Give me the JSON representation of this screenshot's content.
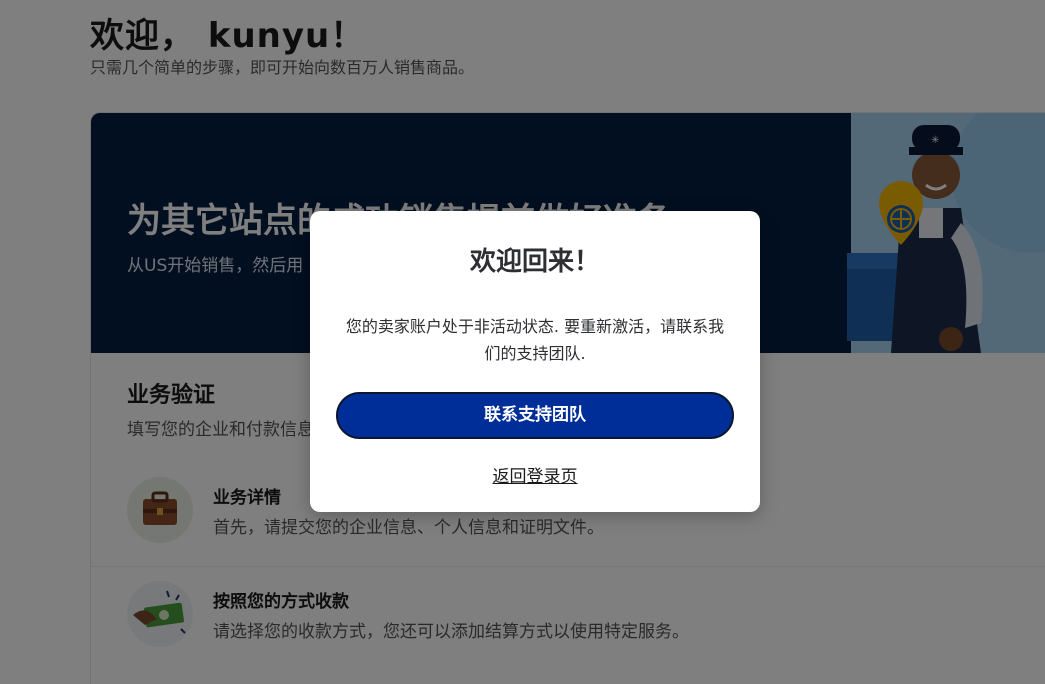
{
  "header": {
    "greeting": "欢迎， kunyu！",
    "subtitle": "只需几个简单的步骤，即可开始向数百万人销售商品。"
  },
  "banner": {
    "title": "为其它站点的成功销售提前做好准备",
    "subtitle": "从US开始销售，然后用"
  },
  "verification": {
    "title": "业务验证",
    "subtitle": "填写您的企业和付款信息"
  },
  "tasks": [
    {
      "icon": "briefcase-icon",
      "title": "业务详情",
      "description": "首先，请提交您的企业信息、个人信息和证明文件。"
    },
    {
      "icon": "cash-payment-icon",
      "title": "按照您的方式收款",
      "description": "请选择您的收款方式，您还可以添加结算方式以使用特定服务。"
    }
  ],
  "modal": {
    "title": "欢迎回来！",
    "message": "您的卖家账户处于非活动状态. 要重新激活，请联系我们的支持团队.",
    "primary_button": "联系支持团队",
    "back_link": "返回登录页"
  },
  "colors": {
    "banner_bg": "#041f41",
    "primary_button_bg": "#002e99",
    "overlay": "rgba(0,0,0,0.5)"
  }
}
